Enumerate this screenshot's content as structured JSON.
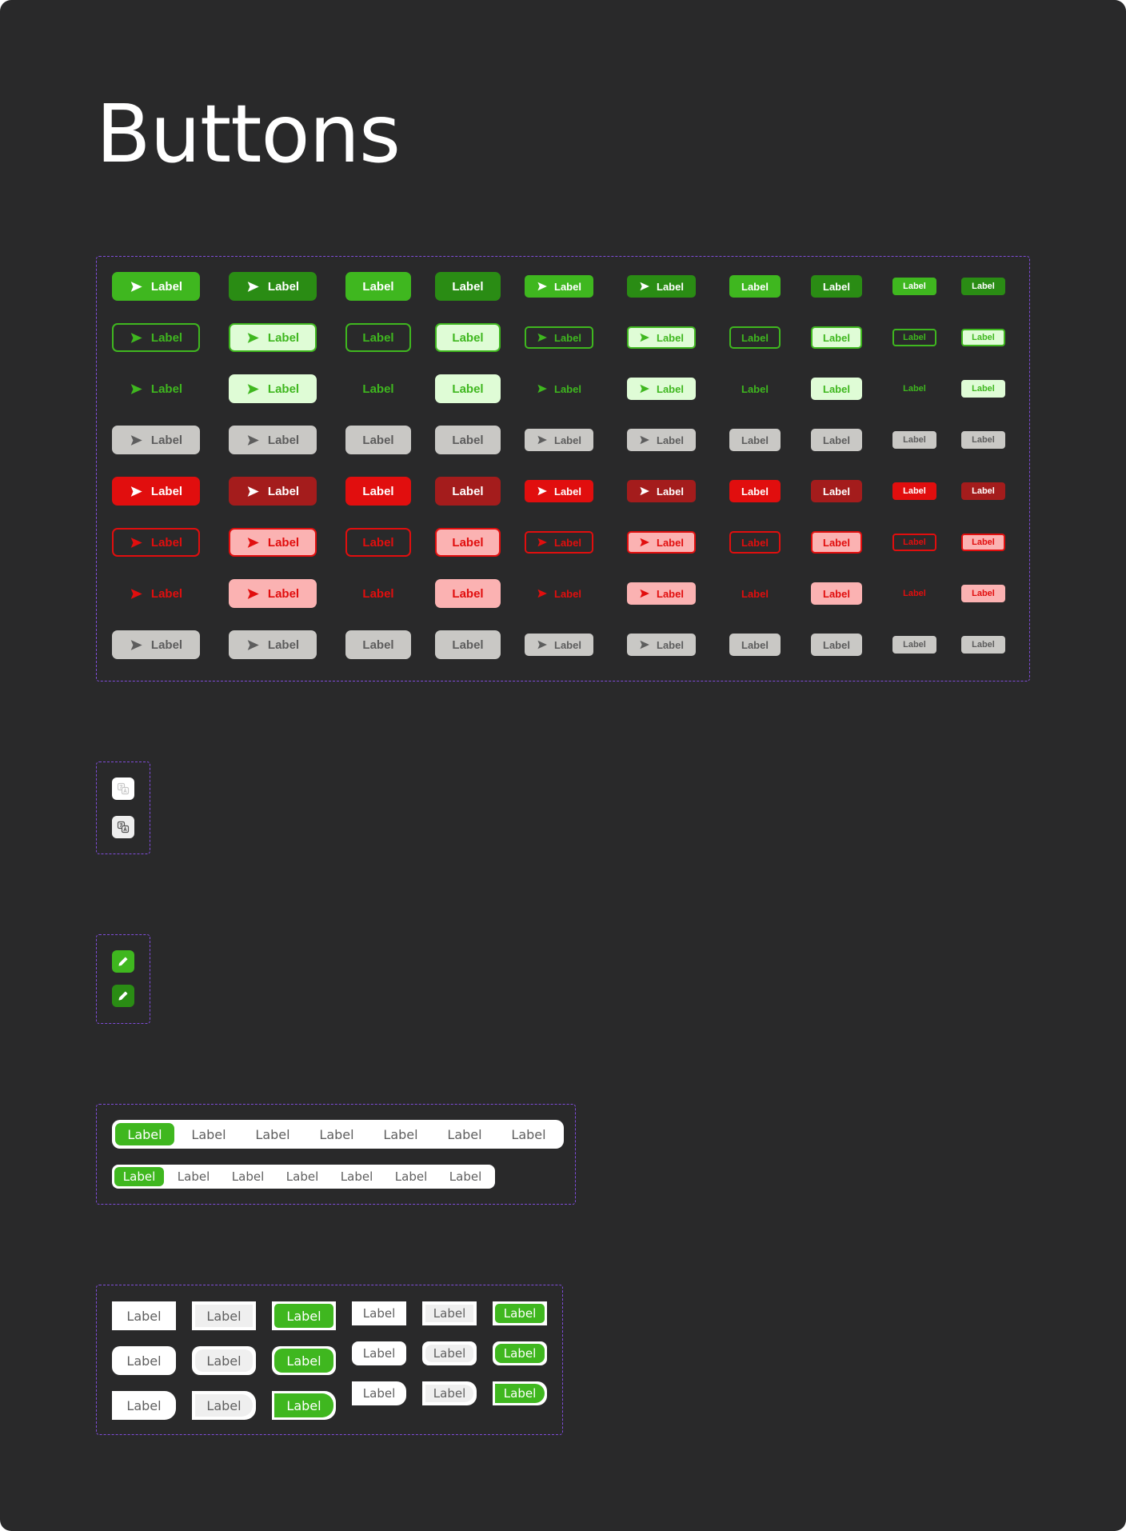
{
  "page": {
    "title": "Buttons"
  },
  "colors": {
    "background": "#29292a",
    "frame_dashes": "#7f4cd9",
    "green": "#3fb71f",
    "green_dark": "#2a8c14",
    "green_light": "#dffcd6",
    "red": "#e10e0e",
    "red_dark": "#a41c1c",
    "red_light": "#fbb2b2",
    "gray": "#c9c8c5",
    "gray_text": "#5d5d5d"
  },
  "variant_grid": {
    "label": "Label",
    "icon": "send-icon",
    "rows": [
      "green-filled",
      "green-outline",
      "green-ghost",
      "neutral-filled",
      "red-filled",
      "red-outline",
      "red-ghost",
      "neutral-disabled"
    ],
    "columns": [
      "large-icon",
      "large-icon-dark",
      "large-text",
      "large-text-dark",
      "medium-icon",
      "medium-icon-dark",
      "medium-text",
      "medium-text-dark",
      "small-text",
      "small-text-dark"
    ]
  },
  "icon_buttons": {
    "translate": {
      "icon": "translate-icon",
      "states": [
        "default",
        "hover"
      ]
    },
    "edit": {
      "icon": "pencil-icon",
      "states": [
        "default",
        "hover"
      ]
    }
  },
  "segmented_controls": [
    {
      "size": "large",
      "items": [
        "Label",
        "Label",
        "Label",
        "Label",
        "Label",
        "Label",
        "Label"
      ],
      "selected_index": 0
    },
    {
      "size": "small",
      "items": [
        "Label",
        "Label",
        "Label",
        "Label",
        "Label",
        "Label",
        "Label"
      ],
      "selected_index": 0
    }
  ],
  "option_buttons": {
    "label": "Label",
    "states": [
      "default",
      "hover",
      "selected"
    ],
    "shapes": [
      "square",
      "rounded",
      "pill-right"
    ]
  }
}
